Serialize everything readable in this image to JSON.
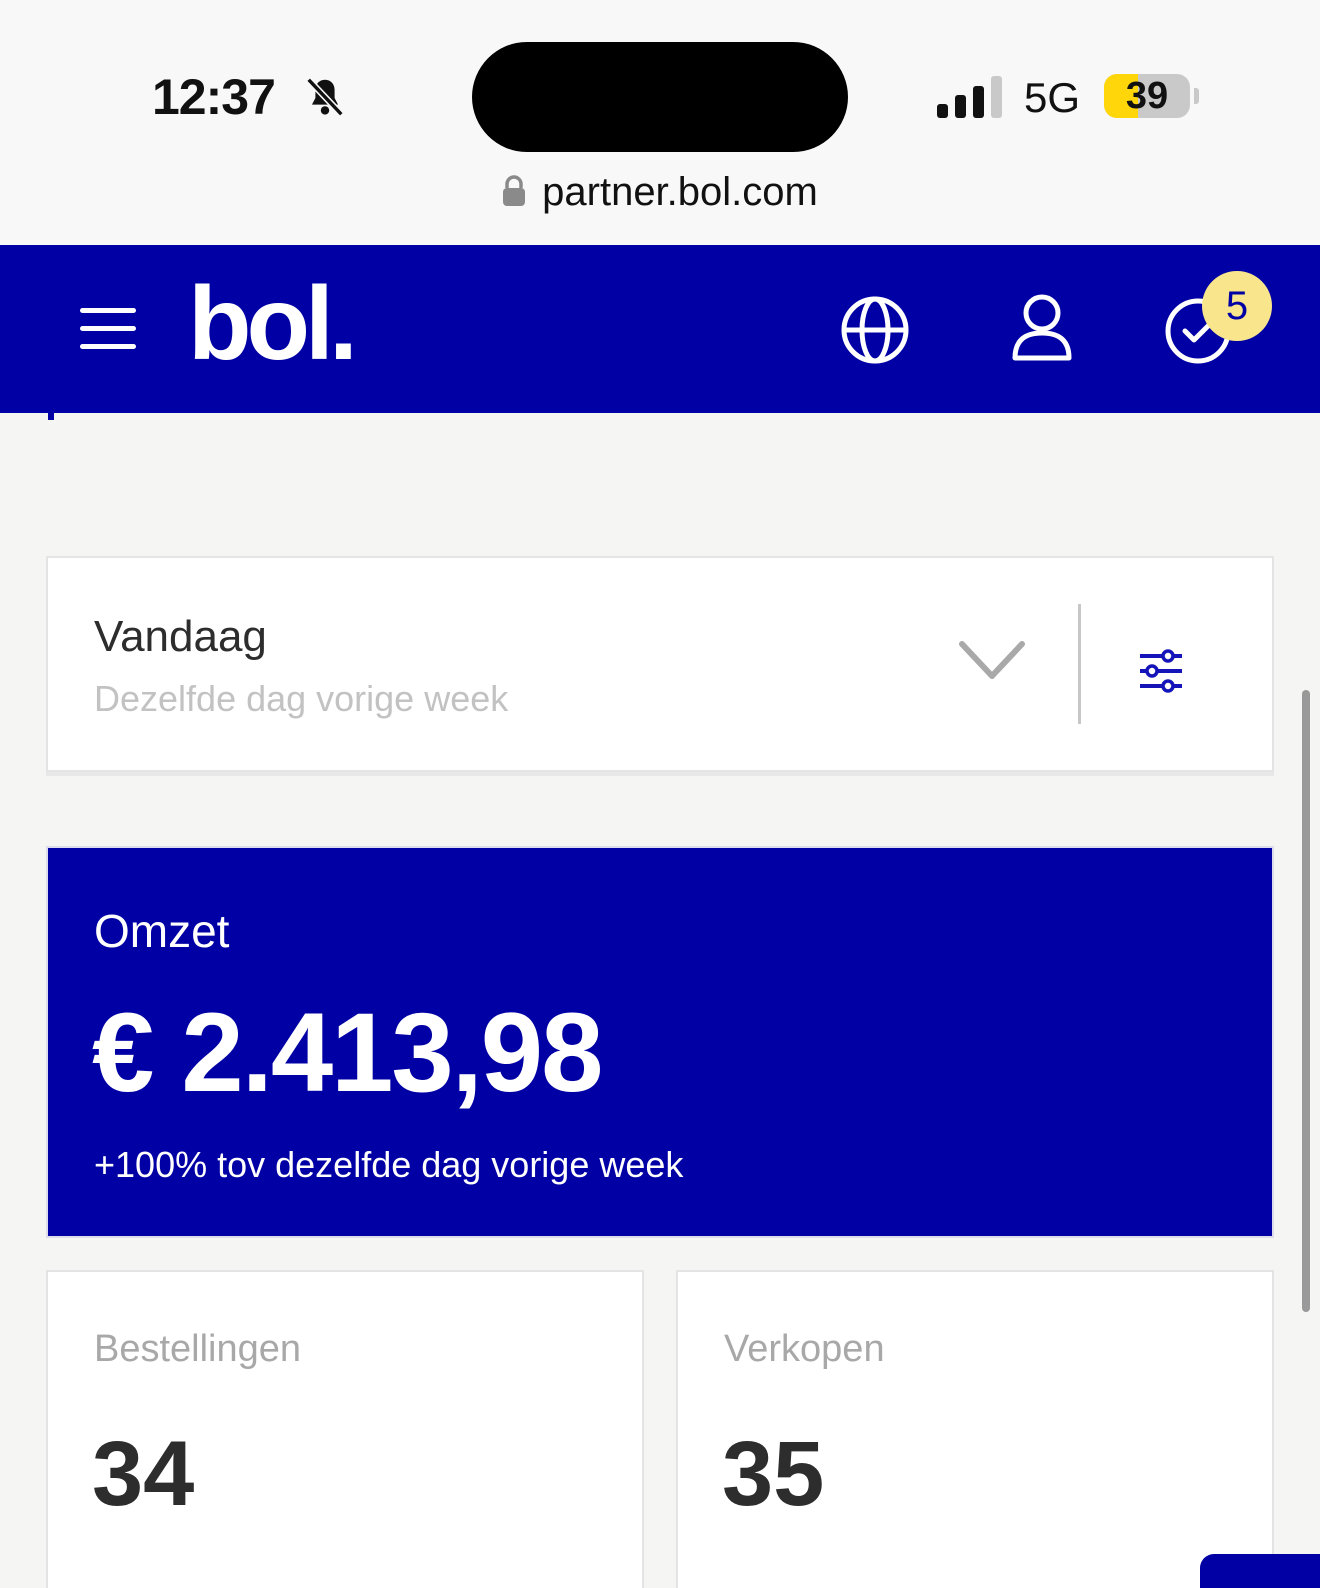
{
  "status_bar": {
    "time": "12:37",
    "network": "5G",
    "battery": "39",
    "battery_level": 0.39,
    "url": "partner.bol.com"
  },
  "header": {
    "logo": "bol.",
    "notification_count": "5",
    "colors": {
      "brand": "#0000a4",
      "badge": "#f8e58c"
    }
  },
  "filter": {
    "period": "Vandaag",
    "comparison": "Dezelfde dag vorige week"
  },
  "revenue": {
    "label": "Omzet",
    "value": "€ 2.413,98",
    "comparison": "+100% tov dezelfde dag vorige week"
  },
  "stats": {
    "orders_label": "Bestellingen",
    "orders_value": "34",
    "sales_label": "Verkopen",
    "sales_value": "35"
  }
}
